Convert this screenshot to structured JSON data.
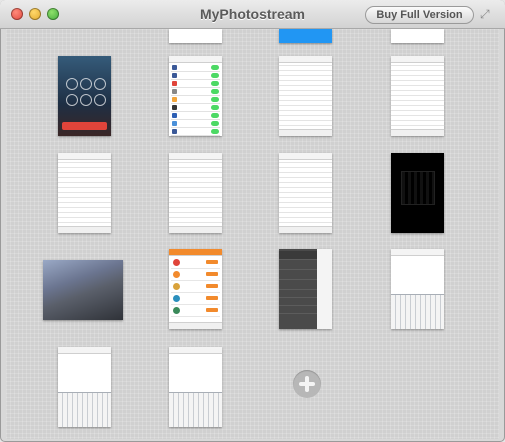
{
  "window": {
    "title": "MyPhotostream"
  },
  "toolbar": {
    "buy_label": "Buy Full Version"
  },
  "icons": {
    "resize": "fullscreen-icon",
    "add": "add-icon"
  },
  "colors": {
    "accent_blue": "#2196f3",
    "orange": "#f28a2c",
    "green": "#4cd964",
    "end_call_red": "#e0443a"
  },
  "photos": [
    {
      "id": "call-screen"
    },
    {
      "id": "settings-list"
    },
    {
      "id": "article-1"
    },
    {
      "id": "article-2"
    },
    {
      "id": "article-3"
    },
    {
      "id": "article-4"
    },
    {
      "id": "article-5"
    },
    {
      "id": "black-screen"
    },
    {
      "id": "building-photo"
    },
    {
      "id": "app-list"
    },
    {
      "id": "side-menu"
    },
    {
      "id": "keyboard-1"
    },
    {
      "id": "keyboard-2"
    },
    {
      "id": "keyboard-3"
    }
  ]
}
